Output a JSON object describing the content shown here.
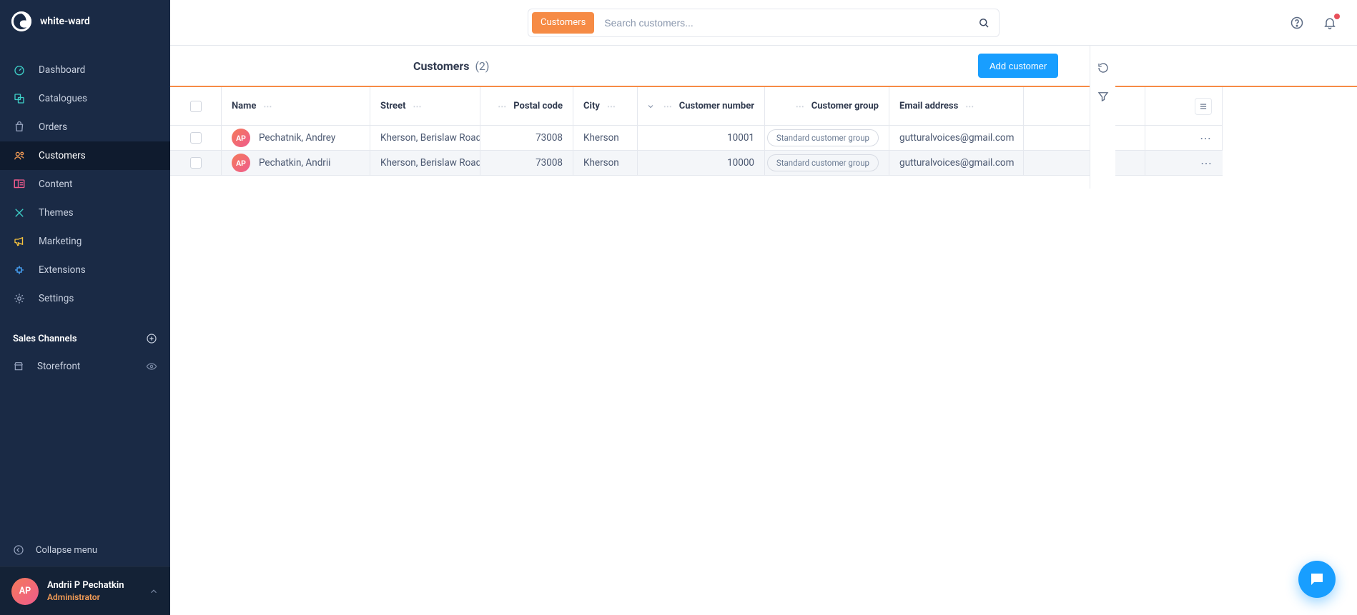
{
  "brand": {
    "name": "white-ward"
  },
  "nav": {
    "items": [
      {
        "label": "Dashboard",
        "icon": "dashboard-icon"
      },
      {
        "label": "Catalogues",
        "icon": "catalogues-icon"
      },
      {
        "label": "Orders",
        "icon": "orders-icon"
      },
      {
        "label": "Customers",
        "icon": "customers-icon",
        "active": true
      },
      {
        "label": "Content",
        "icon": "content-icon"
      },
      {
        "label": "Themes",
        "icon": "themes-icon"
      },
      {
        "label": "Marketing",
        "icon": "marketing-icon"
      },
      {
        "label": "Extensions",
        "icon": "extensions-icon"
      },
      {
        "label": "Settings",
        "icon": "settings-icon"
      }
    ]
  },
  "channels": {
    "heading": "Sales Channels",
    "add_tooltip": "Add sales channel",
    "items": [
      {
        "label": "Storefront"
      }
    ]
  },
  "collapse_label": "Collapse menu",
  "user": {
    "initials": "AP",
    "name": "Andrii P Pechatkin",
    "role": "Administrator"
  },
  "search": {
    "tag": "Customers",
    "placeholder": "Search customers..."
  },
  "page": {
    "title": "Customers",
    "count": "(2)",
    "add_button": "Add customer"
  },
  "columns": {
    "name": "Name",
    "street": "Street",
    "postal": "Postal code",
    "city": "City",
    "customer_number": "Customer number",
    "customer_group": "Customer group",
    "email": "Email address"
  },
  "rows": [
    {
      "initials": "AP",
      "name": "Pechatnik, Andrey",
      "street": "Kherson, Berislaw Road",
      "postal": "73008",
      "city": "Kherson",
      "number": "10001",
      "group": "Standard customer group",
      "email": "gutturalvoices@gmail.com"
    },
    {
      "initials": "AP",
      "name": "Pechatkin, Andrii",
      "street": "Kherson, Berislaw Road",
      "postal": "73008",
      "city": "Kherson",
      "number": "10000",
      "group": "Standard customer group",
      "email": "gutturalvoices@gmail.com"
    }
  ]
}
